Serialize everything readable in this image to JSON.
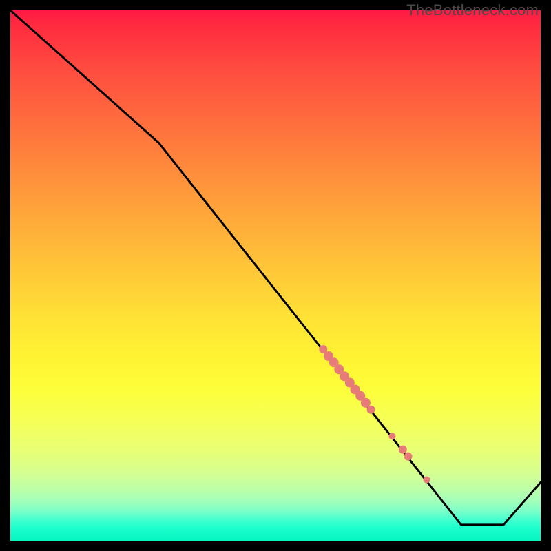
{
  "watermark": "TheBottleneck.com",
  "chart_data": {
    "type": "line",
    "title": "",
    "xlabel": "",
    "ylabel": "",
    "x_range": [
      0,
      100
    ],
    "y_range": [
      0,
      100
    ],
    "series": [
      {
        "name": "curve",
        "color": "#000000",
        "points": [
          {
            "x": 0,
            "y": 100
          },
          {
            "x": 28,
            "y": 75
          },
          {
            "x": 85,
            "y": 3
          },
          {
            "x": 93,
            "y": 3
          },
          {
            "x": 100,
            "y": 11
          }
        ]
      }
    ],
    "markers": {
      "name": "highlighted-segment",
      "color": "#e77b77",
      "points": [
        {
          "x": 59.0,
          "y": 36.1,
          "r": 6
        },
        {
          "x": 60.0,
          "y": 34.8,
          "r": 7
        },
        {
          "x": 61.0,
          "y": 33.6,
          "r": 7
        },
        {
          "x": 62.0,
          "y": 32.3,
          "r": 7
        },
        {
          "x": 63.0,
          "y": 31.0,
          "r": 7
        },
        {
          "x": 64.0,
          "y": 29.8,
          "r": 7
        },
        {
          "x": 65.0,
          "y": 28.5,
          "r": 7
        },
        {
          "x": 66.0,
          "y": 27.3,
          "r": 7
        },
        {
          "x": 67.0,
          "y": 26.0,
          "r": 7
        },
        {
          "x": 68.0,
          "y": 24.7,
          "r": 6
        },
        {
          "x": 72.0,
          "y": 19.7,
          "r": 5
        },
        {
          "x": 74.0,
          "y": 17.2,
          "r": 6
        },
        {
          "x": 75.0,
          "y": 15.9,
          "r": 6
        },
        {
          "x": 78.5,
          "y": 11.5,
          "r": 5
        }
      ]
    },
    "background_gradient": {
      "type": "vertical",
      "stops": [
        {
          "pos": 0.0,
          "color": "#ff1a44"
        },
        {
          "pos": 0.5,
          "color": "#ffca38"
        },
        {
          "pos": 0.72,
          "color": "#fdff3c"
        },
        {
          "pos": 1.0,
          "color": "#05f5c0"
        }
      ]
    }
  }
}
